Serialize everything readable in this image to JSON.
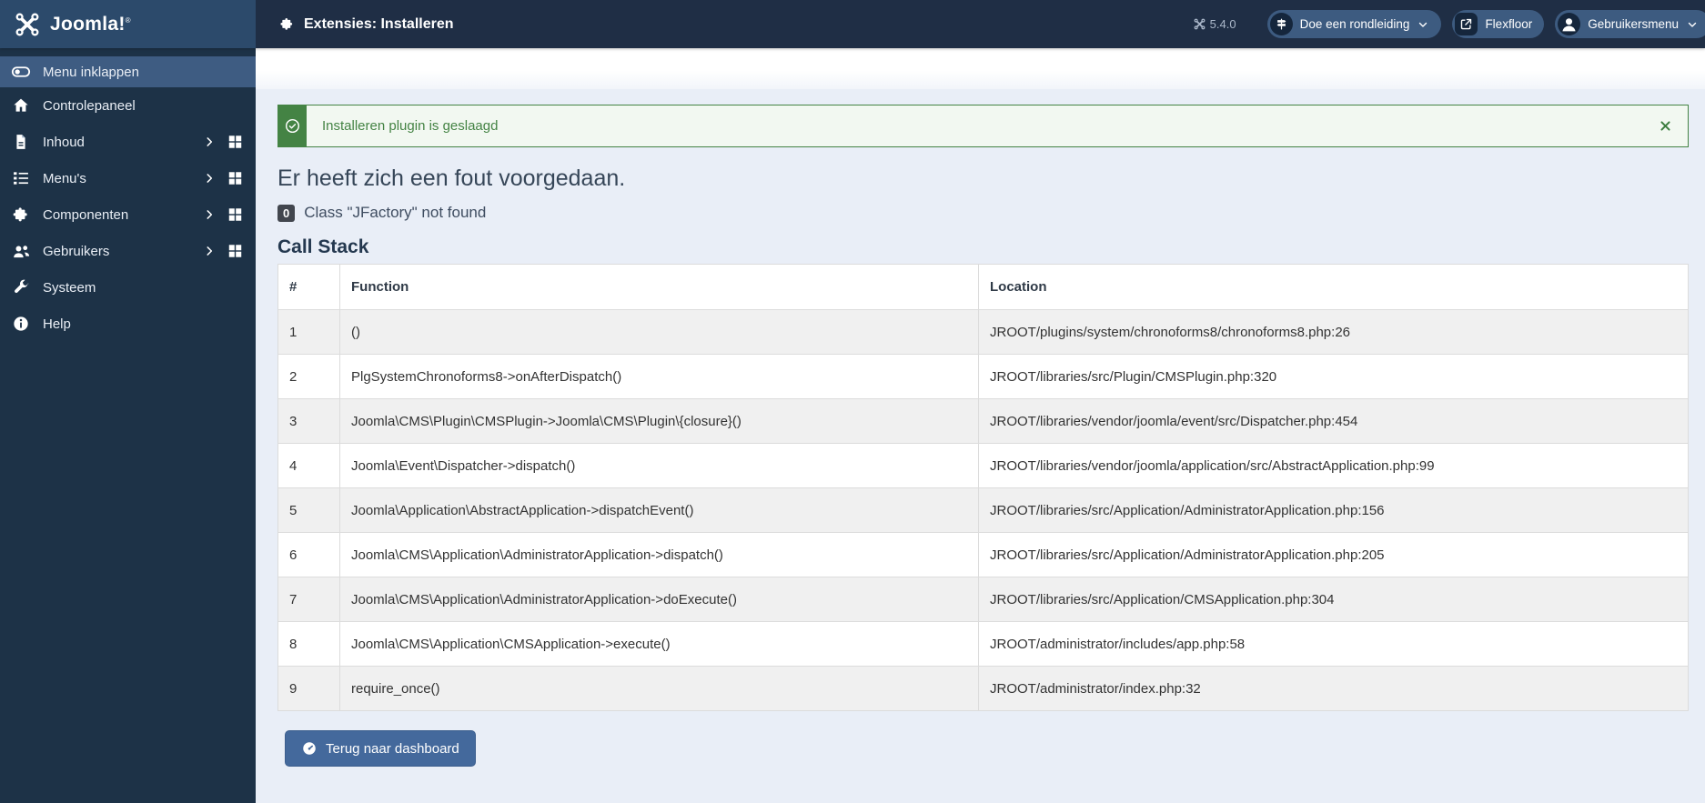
{
  "header": {
    "logo_text": "Joomla!",
    "logo_mark": "®",
    "page_title": "Extensies: Installeren",
    "version": "5.4.0",
    "tour_button": "Doe een rondleiding",
    "site_button": "Flexfloor",
    "user_menu_button": "Gebruikersmenu"
  },
  "sidebar": {
    "toggle_label": "Menu inklappen",
    "items": [
      {
        "label": "Controlepaneel",
        "icon": "home-icon",
        "has_children": false,
        "has_dashboard": false
      },
      {
        "label": "Inhoud",
        "icon": "file-icon",
        "has_children": true,
        "has_dashboard": true
      },
      {
        "label": "Menu's",
        "icon": "list-icon",
        "has_children": true,
        "has_dashboard": true
      },
      {
        "label": "Componenten",
        "icon": "puzzle-icon",
        "has_children": true,
        "has_dashboard": true
      },
      {
        "label": "Gebruikers",
        "icon": "users-icon",
        "has_children": true,
        "has_dashboard": true
      },
      {
        "label": "Systeem",
        "icon": "wrench-icon",
        "has_children": false,
        "has_dashboard": false
      },
      {
        "label": "Help",
        "icon": "info-icon",
        "has_children": false,
        "has_dashboard": false
      }
    ]
  },
  "alert": {
    "message": "Installeren plugin is geslaagd"
  },
  "error": {
    "heading": "Er heeft zich een fout voorgedaan.",
    "badge": "0",
    "message": "Class \"JFactory\" not found"
  },
  "callstack": {
    "title": "Call Stack",
    "columns": [
      "#",
      "Function",
      "Location"
    ],
    "rows": [
      {
        "n": "1",
        "function": "()",
        "location": "JROOT/plugins/system/chronoforms8/chronoforms8.php:26"
      },
      {
        "n": "2",
        "function": "PlgSystemChronoforms8->onAfterDispatch()",
        "location": "JROOT/libraries/src/Plugin/CMSPlugin.php:320"
      },
      {
        "n": "3",
        "function": "Joomla\\CMS\\Plugin\\CMSPlugin->Joomla\\CMS\\Plugin\\{closure}()",
        "location": "JROOT/libraries/vendor/joomla/event/src/Dispatcher.php:454"
      },
      {
        "n": "4",
        "function": "Joomla\\Event\\Dispatcher->dispatch()",
        "location": "JROOT/libraries/vendor/joomla/application/src/AbstractApplication.php:99"
      },
      {
        "n": "5",
        "function": "Joomla\\Application\\AbstractApplication->dispatchEvent()",
        "location": "JROOT/libraries/src/Application/AdministratorApplication.php:156"
      },
      {
        "n": "6",
        "function": "Joomla\\CMS\\Application\\AdministratorApplication->dispatch()",
        "location": "JROOT/libraries/src/Application/AdministratorApplication.php:205"
      },
      {
        "n": "7",
        "function": "Joomla\\CMS\\Application\\AdministratorApplication->doExecute()",
        "location": "JROOT/libraries/src/Application/CMSApplication.php:304"
      },
      {
        "n": "8",
        "function": "Joomla\\CMS\\Application\\CMSApplication->execute()",
        "location": "JROOT/administrator/includes/app.php:58"
      },
      {
        "n": "9",
        "function": "require_once()",
        "location": "JROOT/administrator/index.php:32"
      }
    ]
  },
  "footer": {
    "back_button": "Terug naar dashboard"
  },
  "colors": {
    "topbar_bg": "#1f2e45",
    "logo_area_bg": "#2c4a6b",
    "sidebar_bg": "#1d3247",
    "sidebar_active_bg": "#3e5c82",
    "pill_bg": "#3d5b80",
    "content_bg": "#e9eef7",
    "success": "#448344",
    "success_bg": "#f2f8f1",
    "button_bg": "#44699c",
    "heading_text": "#364658",
    "table_stripe": "#f0f0f0"
  }
}
